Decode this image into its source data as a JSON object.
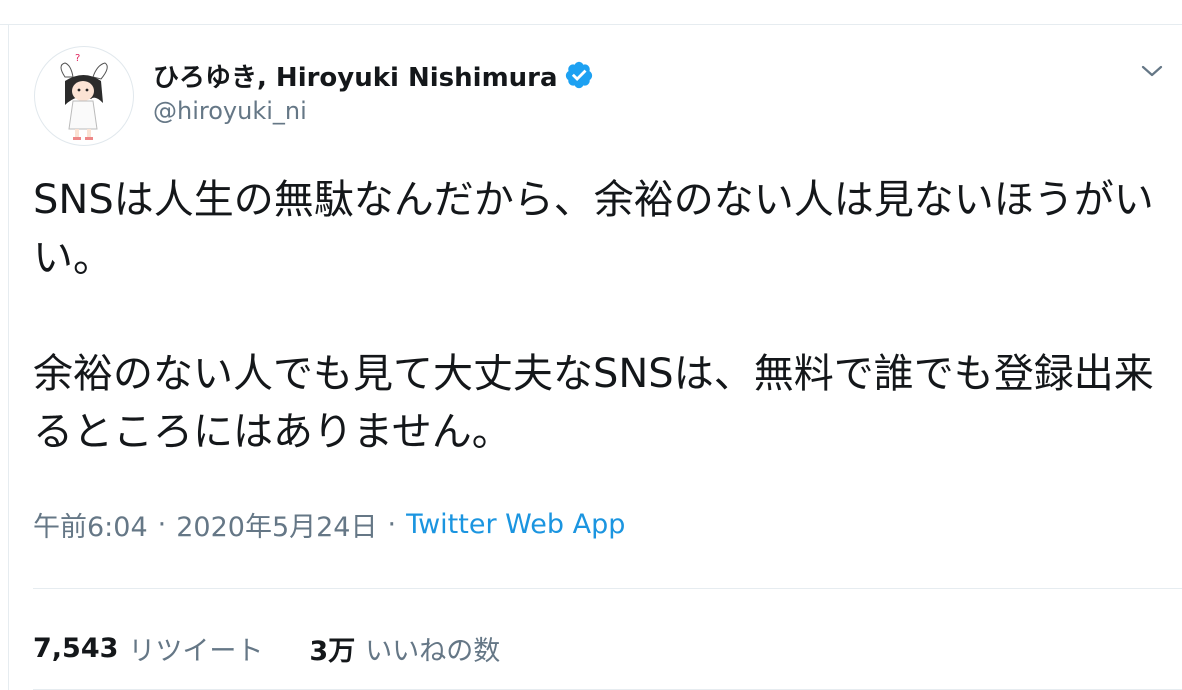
{
  "author": {
    "display_name": "ひろゆき, Hiroyuki Nishimura",
    "handle": "@hiroyuki_ni",
    "verified": true,
    "avatar_icon": "bunny-girl-avatar-icon"
  },
  "tweet": {
    "paragraphs": [
      "SNSは人生の無駄なんだから、余裕のない人は見ないほうがいい。",
      "余裕のない人でも見て大丈夫なSNSは、無料で誰でも登録出来るところにはありません。"
    ]
  },
  "meta": {
    "time": "午前6:04",
    "separator": "·",
    "date": "2020年5月24日",
    "source": "Twitter Web App"
  },
  "stats": {
    "retweets": {
      "count": "7,543",
      "label": "リツイート"
    },
    "likes": {
      "count": "3万",
      "label": "いいねの数"
    }
  },
  "colors": {
    "accent": "#1b95e0",
    "verified": "#1da1f2",
    "secondary_text": "#657786",
    "border": "#e6ecf0"
  }
}
